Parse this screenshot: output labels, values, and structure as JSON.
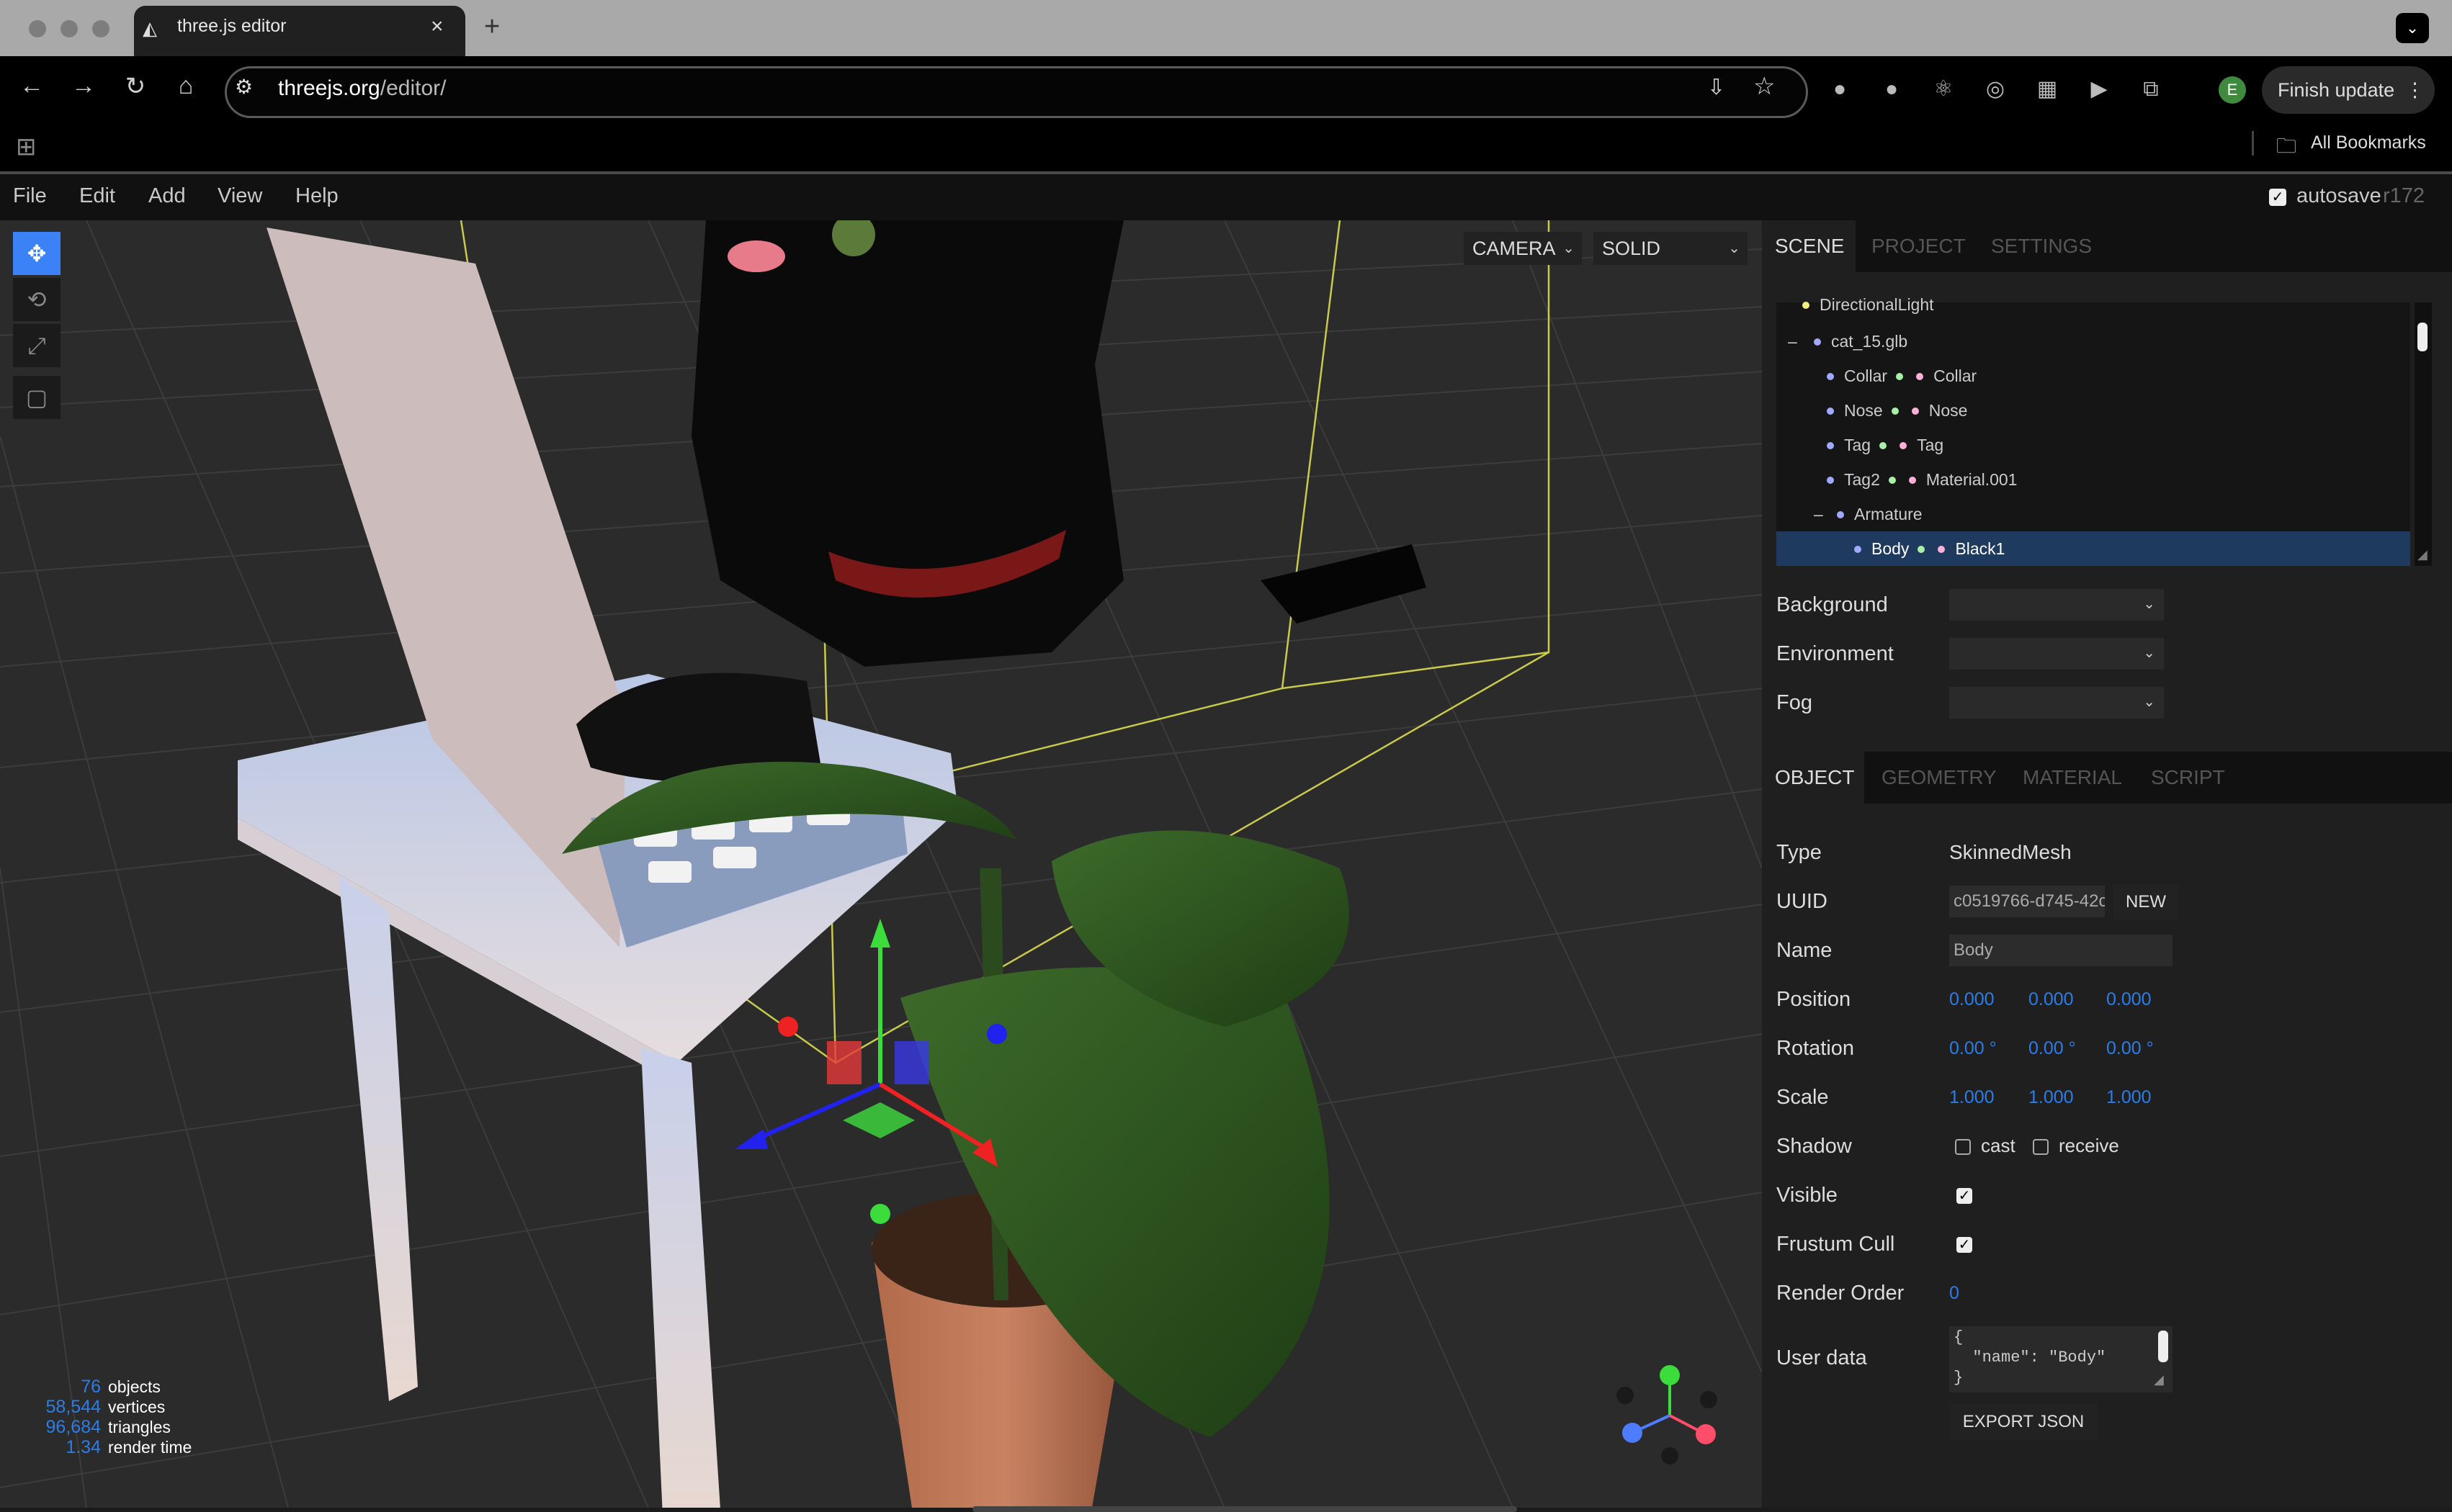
{
  "browser": {
    "tab_title": "three.js editor",
    "tab_icon": "threejs-logo-icon",
    "url_host": "threejs.org",
    "url_path": "/editor/",
    "finish_update": "Finish update",
    "profile_initial": "E",
    "all_bookmarks": "All Bookmarks"
  },
  "menu": {
    "file": "File",
    "edit": "Edit",
    "add": "Add",
    "view": "View",
    "help": "Help",
    "autosave": "autosave",
    "version": "r172"
  },
  "viewport": {
    "camera_select": "CAMERA",
    "shading_select": "SOLID",
    "info": [
      {
        "value": "76",
        "label": "objects"
      },
      {
        "value": "58,544",
        "label": "vertices"
      },
      {
        "value": "96,684",
        "label": "triangles"
      },
      {
        "value": "1.34",
        "label": "render time"
      }
    ]
  },
  "sidebar": {
    "tabs": [
      "SCENE",
      "PROJECT",
      "SETTINGS"
    ],
    "outliner": [
      {
        "toggle": "",
        "name": "DirectionalLight",
        "material": ""
      },
      {
        "toggle": "–",
        "name": "cat_15.glb",
        "material": ""
      },
      {
        "toggle": "",
        "name": "Collar",
        "material": "Collar"
      },
      {
        "toggle": "",
        "name": "Nose",
        "material": "Nose"
      },
      {
        "toggle": "",
        "name": "Tag",
        "material": "Tag"
      },
      {
        "toggle": "",
        "name": "Tag2",
        "material": "Material.001"
      },
      {
        "toggle": "–",
        "name": "Armature",
        "material": ""
      },
      {
        "toggle": "",
        "name": "Body",
        "material": "Black1"
      }
    ],
    "scene_props": {
      "background": "Background",
      "environment": "Environment",
      "fog": "Fog"
    },
    "object_tabs": [
      "OBJECT",
      "GEOMETRY",
      "MATERIAL",
      "SCRIPT"
    ],
    "object": {
      "type_label": "Type",
      "type_value": "SkinnedMesh",
      "uuid_label": "UUID",
      "uuid_value": "c0519766-d745-42c",
      "new_button": "NEW",
      "name_label": "Name",
      "name_value": "Body",
      "position_label": "Position",
      "position": [
        "0.000",
        "0.000",
        "0.000"
      ],
      "rotation_label": "Rotation",
      "rotation": [
        "0.00 °",
        "0.00 °",
        "0.00 °"
      ],
      "scale_label": "Scale",
      "scale": [
        "1.000",
        "1.000",
        "1.000"
      ],
      "shadow_label": "Shadow",
      "cast_label": "cast",
      "receive_label": "receive",
      "visible_label": "Visible",
      "frustum_label": "Frustum Cull",
      "render_order_label": "Render Order",
      "render_order_value": "0",
      "userdata_label": "User data",
      "userdata_value": "{\n  \"name\": \"Body\"\n}",
      "export_button": "EXPORT JSON"
    }
  },
  "colors": {
    "accent_blue": "#3b82f6",
    "number_blue": "#2b7de9",
    "selection": "#1e3a5f"
  }
}
